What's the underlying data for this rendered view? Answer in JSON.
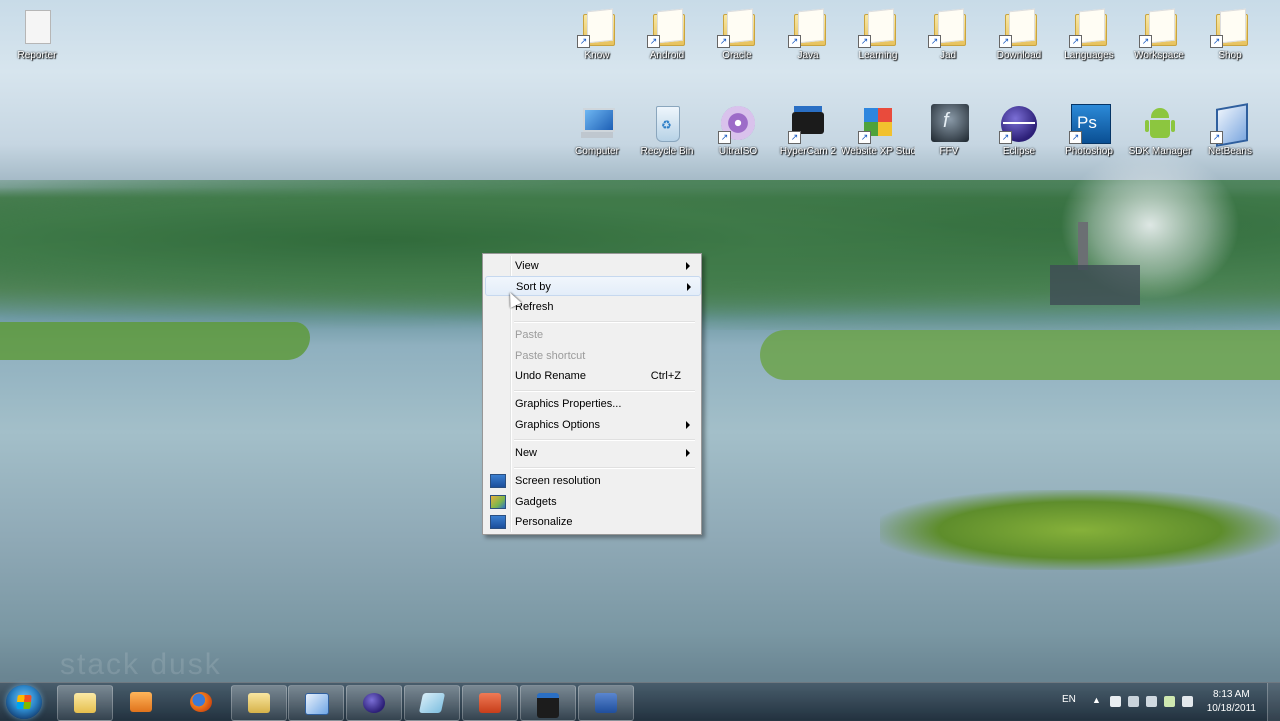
{
  "desktop": {
    "left_icon": {
      "label": "Reporter"
    },
    "top_row": [
      {
        "label": "Know"
      },
      {
        "label": "Android"
      },
      {
        "label": "Oracle"
      },
      {
        "label": "Java"
      },
      {
        "label": "Learning"
      },
      {
        "label": "Jad"
      },
      {
        "label": "Download"
      },
      {
        "label": "Languages"
      },
      {
        "label": "Workspace"
      },
      {
        "label": "Shop"
      }
    ],
    "second_row": [
      {
        "label": "Computer",
        "icon": "computer-icon",
        "color": "#2a7fd4"
      },
      {
        "label": "Recycle Bin",
        "icon": "recycle-bin-icon",
        "color": "#cfe3f3"
      },
      {
        "label": "UltraISO",
        "icon": "disc-icon",
        "color": "#8a4fb8"
      },
      {
        "label": "HyperCam 2",
        "icon": "camera-icon",
        "color": "#1a1a1a"
      },
      {
        "label": "Website XP Studio",
        "icon": "cube-icon",
        "color": "#4fa23a"
      },
      {
        "label": "FFV",
        "icon": "flash-icon",
        "color": "#2c3e50"
      },
      {
        "label": "Eclipse",
        "icon": "eclipse-icon",
        "color": "#3a2f8f"
      },
      {
        "label": "Photoshop",
        "icon": "photoshop-icon",
        "color": "#0b5a9c"
      },
      {
        "label": "SDK Manager",
        "icon": "android-icon",
        "color": "#8cc63f"
      },
      {
        "label": "NetBeans",
        "icon": "netbeans-icon",
        "color": "#5a8fd6"
      }
    ]
  },
  "context_menu": {
    "items": [
      {
        "label": "View",
        "submenu": true
      },
      {
        "label": "Sort by",
        "submenu": true
      },
      {
        "label": "Refresh"
      },
      {
        "label": "Paste",
        "disabled": true
      },
      {
        "label": "Paste shortcut",
        "disabled": true
      },
      {
        "label": "Undo Rename",
        "shortcut": "Ctrl+Z"
      },
      {
        "label": "Graphics Properties..."
      },
      {
        "label": "Graphics Options",
        "submenu": true
      },
      {
        "label": "New",
        "submenu": true
      },
      {
        "label": "Screen resolution"
      },
      {
        "label": "Gadgets"
      },
      {
        "label": "Personalize"
      }
    ]
  },
  "taskbar": {
    "language": "EN",
    "time": "8:13 AM",
    "date": "10/18/2011",
    "pinned": [
      {
        "name": "explorer",
        "color": "#f3d36b"
      },
      {
        "name": "media-player",
        "color": "#f28b2a"
      },
      {
        "name": "firefox",
        "color": "#e85d1c"
      },
      {
        "name": "folder",
        "color": "#e8c860"
      },
      {
        "name": "virtualbox",
        "color": "#6fa6e6"
      },
      {
        "name": "eclipse",
        "color": "#3a2f8f"
      },
      {
        "name": "notepad",
        "color": "#9ed0e8"
      },
      {
        "name": "powerpoint",
        "color": "#d24726"
      },
      {
        "name": "hypercam",
        "color": "#222222"
      },
      {
        "name": "word",
        "color": "#2b5797"
      }
    ]
  },
  "watermark": "stack dusk"
}
